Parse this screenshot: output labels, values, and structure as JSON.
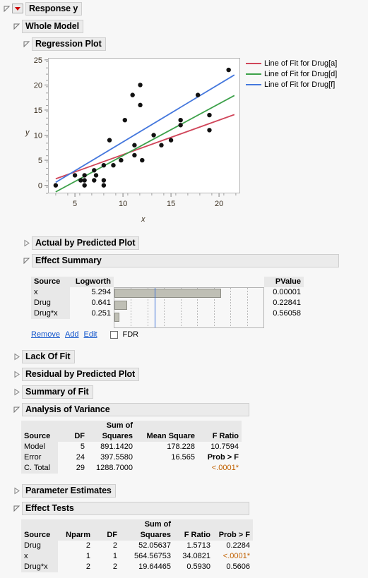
{
  "report": {
    "response_title": "Response y",
    "whole_model_title": "Whole Model",
    "regression_plot_title": "Regression Plot",
    "actual_by_predicted_title": "Actual by Predicted Plot",
    "effect_summary_title": "Effect Summary",
    "lack_of_fit_title": "Lack Of Fit",
    "residual_by_predicted_title": "Residual by Predicted Plot",
    "summary_of_fit_title": "Summary of Fit",
    "anova_title": "Analysis of Variance",
    "parameter_estimates_title": "Parameter Estimates",
    "effect_tests_title": "Effect Tests"
  },
  "chart_data": {
    "type": "scatter",
    "title": "Regression Plot",
    "xlabel": "x",
    "ylabel": "y",
    "xlim": [
      2.2,
      22.2
    ],
    "ylim": [
      -1.6,
      25.4
    ],
    "xticks": [
      5,
      10,
      15,
      20
    ],
    "yticks": [
      0,
      5,
      10,
      15,
      20,
      25
    ],
    "grid": false,
    "legend_position": "right",
    "points": [
      [
        3.0,
        0
      ],
      [
        5.0,
        2
      ],
      [
        5.6,
        1
      ],
      [
        6.0,
        2
      ],
      [
        6.0,
        1
      ],
      [
        6.0,
        0
      ],
      [
        7.0,
        3
      ],
      [
        7.2,
        2
      ],
      [
        7.0,
        1
      ],
      [
        8.0,
        4
      ],
      [
        8.0,
        1
      ],
      [
        8.0,
        0
      ],
      [
        8.6,
        9
      ],
      [
        9.0,
        4
      ],
      [
        9.8,
        5
      ],
      [
        10.2,
        13
      ],
      [
        11.0,
        18
      ],
      [
        11.2,
        8
      ],
      [
        11.2,
        6
      ],
      [
        11.8,
        20
      ],
      [
        11.8,
        16
      ],
      [
        12.0,
        5
      ],
      [
        13.2,
        10
      ],
      [
        14.0,
        8
      ],
      [
        15.0,
        9
      ],
      [
        16.0,
        13
      ],
      [
        16.0,
        12
      ],
      [
        17.8,
        18
      ],
      [
        19.0,
        14
      ],
      [
        19.0,
        11
      ],
      [
        21.0,
        23
      ]
    ],
    "series": [
      {
        "name": "Line of Fit for Drug[a]",
        "color": "#d0465a",
        "x": [
          3.0,
          21.6
        ],
        "y": [
          1.3,
          14.1
        ]
      },
      {
        "name": "Line of Fit for Drug[d]",
        "color": "#3da14a",
        "x": [
          3.0,
          21.6
        ],
        "y": [
          -1.3,
          17.9
        ]
      },
      {
        "name": "Line of Fit for Drug[f]",
        "color": "#4477dd",
        "x": [
          3.0,
          21.6
        ],
        "y": [
          0.6,
          22.0
        ]
      }
    ]
  },
  "effect_summary": {
    "headers": [
      "Source",
      "Logworth",
      "",
      "PValue"
    ],
    "rows": [
      {
        "source": "x",
        "logworth": "5.294",
        "pvalue": "0.00001",
        "bar": 5.294
      },
      {
        "source": "Drug",
        "logworth": "0.641",
        "pvalue": "0.22841",
        "bar": 0.641
      },
      {
        "source": "Drug*x",
        "logworth": "0.251",
        "pvalue": "0.56058",
        "bar": 0.251
      }
    ],
    "bar_max": 7.4,
    "reference": 2.0,
    "remove_label": "Remove",
    "add_label": "Add",
    "edit_label": "Edit",
    "fdr_label": "FDR"
  },
  "anova": {
    "headers": [
      "Source",
      "DF",
      "Sum of\nSquares",
      "Mean Square",
      "F Ratio"
    ],
    "header_sum_of": "Sum of",
    "header_squares": "Squares",
    "header_source": "Source",
    "header_df": "DF",
    "header_mean_square": "Mean Square",
    "header_f_ratio": "F Ratio",
    "prob_label": "Prob > F",
    "rows": [
      {
        "source": "Model",
        "df": "5",
        "ss": "891.1420",
        "ms": "178.228",
        "f": "10.7594"
      },
      {
        "source": "Error",
        "df": "24",
        "ss": "397.5580",
        "ms": "16.565",
        "f": ""
      },
      {
        "source": "C. Total",
        "df": "29",
        "ss": "1288.7000",
        "ms": "",
        "f": ""
      }
    ],
    "prob_value": "<.0001*"
  },
  "effect_tests": {
    "header_source": "Source",
    "header_nparm": "Nparm",
    "header_df": "DF",
    "header_sum_of": "Sum of",
    "header_squares": "Squares",
    "header_f_ratio": "F Ratio",
    "header_prob": "Prob > F",
    "rows": [
      {
        "source": "Drug",
        "nparm": "2",
        "df": "2",
        "ss": "52.05637",
        "f": "1.5713",
        "p": "0.2284",
        "sig": false
      },
      {
        "source": "x",
        "nparm": "1",
        "df": "1",
        "ss": "564.56753",
        "f": "34.0821",
        "p": "<.0001*",
        "sig": true
      },
      {
        "source": "Drug*x",
        "nparm": "2",
        "df": "2",
        "ss": "19.64465",
        "f": "0.5930",
        "p": "0.5606",
        "sig": false
      }
    ]
  }
}
